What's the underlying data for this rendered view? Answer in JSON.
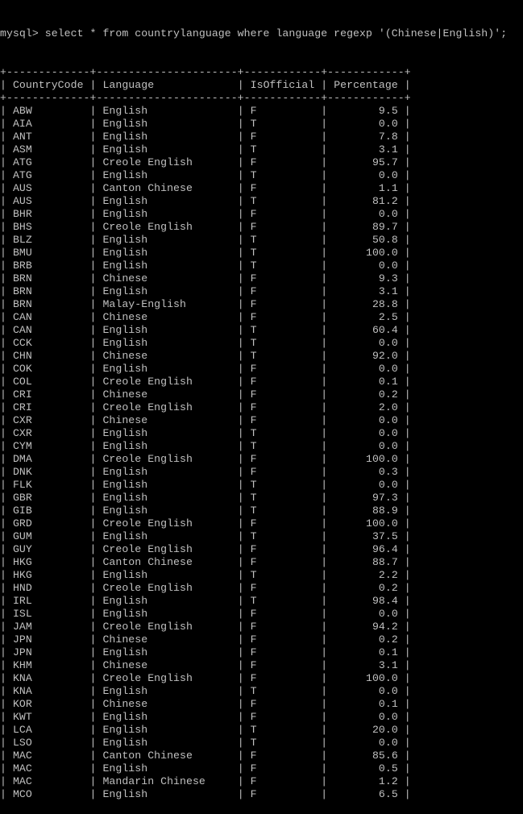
{
  "terminal": {
    "prompt": "mysql>",
    "command": "select * from countrylanguage where language regexp '(Chinese|English)';"
  },
  "table": {
    "columns": [
      "CountryCode",
      "Language",
      "IsOfficial",
      "Percentage"
    ],
    "rows": [
      [
        "ABW",
        "English",
        "F",
        "9.5"
      ],
      [
        "AIA",
        "English",
        "T",
        "0.0"
      ],
      [
        "ANT",
        "English",
        "F",
        "7.8"
      ],
      [
        "ASM",
        "English",
        "T",
        "3.1"
      ],
      [
        "ATG",
        "Creole English",
        "F",
        "95.7"
      ],
      [
        "ATG",
        "English",
        "T",
        "0.0"
      ],
      [
        "AUS",
        "Canton Chinese",
        "F",
        "1.1"
      ],
      [
        "AUS",
        "English",
        "T",
        "81.2"
      ],
      [
        "BHR",
        "English",
        "F",
        "0.0"
      ],
      [
        "BHS",
        "Creole English",
        "F",
        "89.7"
      ],
      [
        "BLZ",
        "English",
        "T",
        "50.8"
      ],
      [
        "BMU",
        "English",
        "T",
        "100.0"
      ],
      [
        "BRB",
        "English",
        "T",
        "0.0"
      ],
      [
        "BRN",
        "Chinese",
        "F",
        "9.3"
      ],
      [
        "BRN",
        "English",
        "F",
        "3.1"
      ],
      [
        "BRN",
        "Malay-English",
        "F",
        "28.8"
      ],
      [
        "CAN",
        "Chinese",
        "F",
        "2.5"
      ],
      [
        "CAN",
        "English",
        "T",
        "60.4"
      ],
      [
        "CCK",
        "English",
        "T",
        "0.0"
      ],
      [
        "CHN",
        "Chinese",
        "T",
        "92.0"
      ],
      [
        "COK",
        "English",
        "F",
        "0.0"
      ],
      [
        "COL",
        "Creole English",
        "F",
        "0.1"
      ],
      [
        "CRI",
        "Chinese",
        "F",
        "0.2"
      ],
      [
        "CRI",
        "Creole English",
        "F",
        "2.0"
      ],
      [
        "CXR",
        "Chinese",
        "F",
        "0.0"
      ],
      [
        "CXR",
        "English",
        "T",
        "0.0"
      ],
      [
        "CYM",
        "English",
        "T",
        "0.0"
      ],
      [
        "DMA",
        "Creole English",
        "F",
        "100.0"
      ],
      [
        "DNK",
        "English",
        "F",
        "0.3"
      ],
      [
        "FLK",
        "English",
        "T",
        "0.0"
      ],
      [
        "GBR",
        "English",
        "T",
        "97.3"
      ],
      [
        "GIB",
        "English",
        "T",
        "88.9"
      ],
      [
        "GRD",
        "Creole English",
        "F",
        "100.0"
      ],
      [
        "GUM",
        "English",
        "T",
        "37.5"
      ],
      [
        "GUY",
        "Creole English",
        "F",
        "96.4"
      ],
      [
        "HKG",
        "Canton Chinese",
        "F",
        "88.7"
      ],
      [
        "HKG",
        "English",
        "T",
        "2.2"
      ],
      [
        "HND",
        "Creole English",
        "F",
        "0.2"
      ],
      [
        "IRL",
        "English",
        "T",
        "98.4"
      ],
      [
        "ISL",
        "English",
        "F",
        "0.0"
      ],
      [
        "JAM",
        "Creole English",
        "F",
        "94.2"
      ],
      [
        "JPN",
        "Chinese",
        "F",
        "0.2"
      ],
      [
        "JPN",
        "English",
        "F",
        "0.1"
      ],
      [
        "KHM",
        "Chinese",
        "F",
        "3.1"
      ],
      [
        "KNA",
        "Creole English",
        "F",
        "100.0"
      ],
      [
        "KNA",
        "English",
        "T",
        "0.0"
      ],
      [
        "KOR",
        "Chinese",
        "F",
        "0.1"
      ],
      [
        "KWT",
        "English",
        "F",
        "0.0"
      ],
      [
        "LCA",
        "English",
        "T",
        "20.0"
      ],
      [
        "LSO",
        "English",
        "T",
        "0.0"
      ],
      [
        "MAC",
        "Canton Chinese",
        "F",
        "85.6"
      ],
      [
        "MAC",
        "English",
        "F",
        "0.5"
      ],
      [
        "MAC",
        "Mandarin Chinese",
        "F",
        "1.2"
      ],
      [
        "MCO",
        "English",
        "F",
        "6.5"
      ]
    ]
  },
  "colors": {
    "background": "#000000",
    "text": "#c0c0c0"
  }
}
